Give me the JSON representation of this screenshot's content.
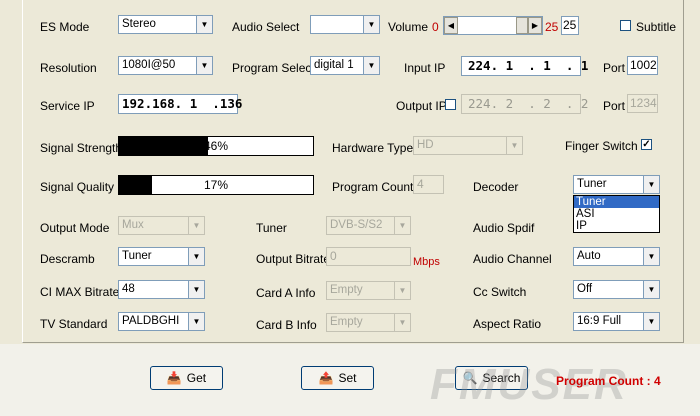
{
  "row1": {
    "es_mode_label": "ES Mode",
    "es_mode_value": "Stereo",
    "audio_select_label": "Audio Select",
    "audio_select_value": "",
    "volume_label": "Volume",
    "volume_min": "0",
    "volume_max": "25",
    "volume_value": "25",
    "subtitle_label": "Subtitle"
  },
  "row2": {
    "resolution_label": "Resolution",
    "resolution_value": "1080I@50",
    "program_select_label": "Program Select",
    "program_select_value": "digital 1",
    "input_ip_label": "Input IP",
    "input_ip_value": "224. 1  . 1  . 1",
    "port_label": "Port",
    "port_value": "1002"
  },
  "row3": {
    "service_ip_label": "Service IP",
    "service_ip_value": "192.168. 1  .136",
    "output_ip_label": "Output IP",
    "output_ip_value": "224. 2  . 2  . 2",
    "port_label": "Port",
    "port_value": "1234"
  },
  "row4": {
    "signal_strength_label": "Signal Strength",
    "signal_strength_value": "46%",
    "signal_strength_fraction": 0.46,
    "hardware_type_label": "Hardware Type",
    "hardware_type_value": "HD",
    "finger_switch_label": "Finger Switch",
    "finger_switch_checked": "✓"
  },
  "row5": {
    "signal_quality_label": "Signal Quality",
    "signal_quality_value": "17%",
    "signal_quality_fraction": 0.17,
    "program_count_label": "Program Count",
    "program_count_value": "4",
    "decoder_label": "Decoder",
    "decoder_value": "Tuner",
    "decoder_options": [
      "Tuner",
      "ASI",
      "IP"
    ]
  },
  "row6": {
    "output_mode_label": "Output Mode",
    "output_mode_value": "Mux",
    "tuner_label": "Tuner",
    "tuner_value": "DVB-S/S2",
    "audio_spdif_label": "Audio Spdif"
  },
  "row7": {
    "descramb_label": "Descramb",
    "descramb_value": "Tuner",
    "output_bitrate_label": "Output Bitrate",
    "output_bitrate_value": "0",
    "output_bitrate_unit": "Mbps",
    "audio_channel_label": "Audio Channel",
    "audio_channel_value": "Auto"
  },
  "row8": {
    "ci_max_label": "CI MAX Bitrate",
    "ci_max_value": "48",
    "card_a_label": "Card A Info",
    "card_a_value": "Empty",
    "cc_switch_label": "Cc Switch",
    "cc_switch_value": "Off"
  },
  "row9": {
    "tv_standard_label": "TV Standard",
    "tv_standard_value": "PALDBGHI",
    "card_b_label": "Card B Info",
    "card_b_value": "Empty",
    "aspect_ratio_label": "Aspect Ratio",
    "aspect_ratio_value": "16:9 Full"
  },
  "buttons": {
    "get": "Get",
    "set": "Set",
    "search": "Search"
  },
  "status": {
    "program_count": "Program Count : 4"
  },
  "watermark": "FMUSER",
  "colors": {
    "background": "#ece9d8",
    "accent_red": "#c00000",
    "selection": "#316ac5"
  }
}
